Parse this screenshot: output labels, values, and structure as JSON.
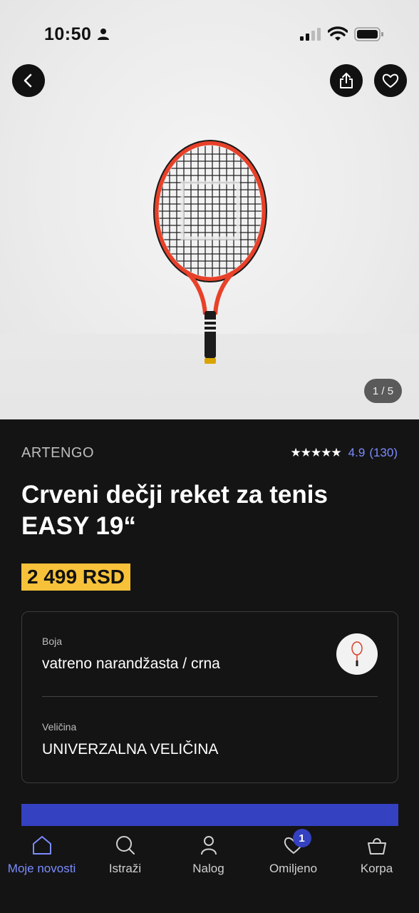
{
  "status_bar": {
    "time": "10:50",
    "icons": [
      "person-icon",
      "signal-icon",
      "wifi-icon",
      "battery-icon"
    ]
  },
  "gallery": {
    "counter": "1 / 5",
    "image": "tennis-racket-photo"
  },
  "product": {
    "brand": "ARTENGO",
    "rating_stars": "★★★★★",
    "rating_value": "4.9",
    "rating_count": "(130)",
    "title": "Crveni dečji reket za tenis EASY 19“",
    "price": "2 499 RSD"
  },
  "options": {
    "color_label": "Boja",
    "color_value": "vatreno narandžasta / crna",
    "size_label": "Veličina",
    "size_value": "UNIVERZALNA VELIČINA"
  },
  "nav": {
    "items": [
      {
        "label": "Moje novosti",
        "icon": "home-icon",
        "active": true
      },
      {
        "label": "Istraži",
        "icon": "search-icon"
      },
      {
        "label": "Nalog",
        "icon": "user-icon"
      },
      {
        "label": "Omiljeno",
        "icon": "heart-icon",
        "badge": "1"
      },
      {
        "label": "Korpa",
        "icon": "basket-icon"
      }
    ]
  },
  "colors": {
    "accent": "#3441c1",
    "link": "#7b8cff",
    "price_bg": "#f7c23a",
    "background": "#141414"
  }
}
